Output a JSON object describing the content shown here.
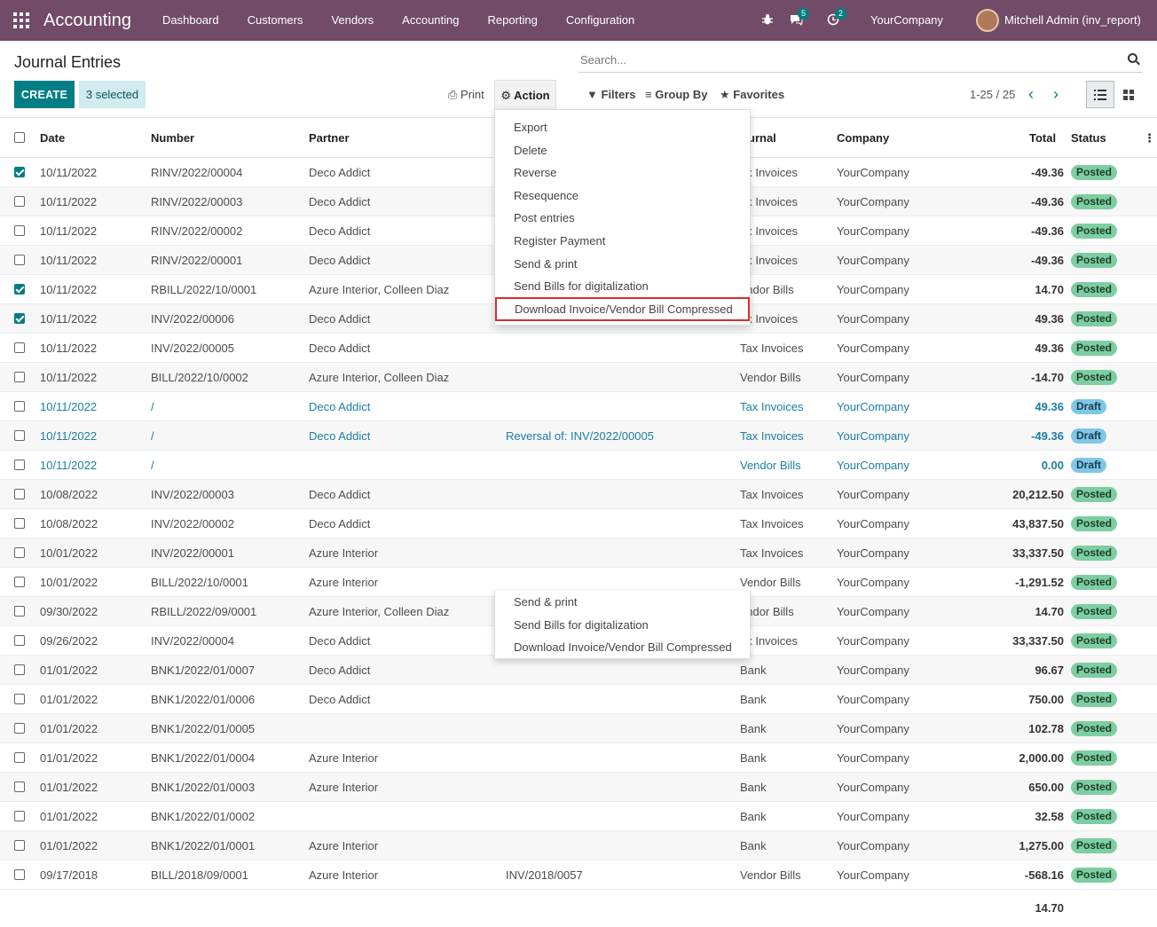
{
  "navbar": {
    "brand": "Accounting",
    "menu": [
      "Dashboard",
      "Customers",
      "Vendors",
      "Accounting",
      "Reporting",
      "Configuration"
    ],
    "chat_count": "5",
    "activity_count": "2",
    "company": "YourCompany",
    "user": "Mitchell Admin (inv_report)"
  },
  "control": {
    "title": "Journal Entries",
    "search_placeholder": "Search...",
    "create_label": "CREATE",
    "selected_label": "3 selected",
    "print_label": "Print",
    "action_label": "Action",
    "filters_label": "Filters",
    "groupby_label": "Group By",
    "favorites_label": "Favorites",
    "pager": "1-25 / 25"
  },
  "action_menu": {
    "items": [
      "Export",
      "Delete",
      "Reverse",
      "Resequence",
      "Post entries",
      "Register Payment",
      "Send & print",
      "Send Bills for digitalization",
      "Download Invoice/Vendor Bill Compressed"
    ],
    "ghost_items": [
      "Send & print",
      "Send Bills for digitalization",
      "Download Invoice/Vendor Bill Compressed"
    ]
  },
  "table": {
    "headers": {
      "date": "Date",
      "number": "Number",
      "partner": "Partner",
      "journal": "urnal",
      "company": "Company",
      "total": "Total",
      "status": "Status"
    },
    "rows": [
      {
        "checked": true,
        "date": "10/11/2022",
        "number": "RINV/2022/00004",
        "partner": "Deco Addict",
        "ref": "",
        "journal": "ax Invoices",
        "company": "YourCompany",
        "total": "-49.36",
        "status": "Posted"
      },
      {
        "checked": false,
        "date": "10/11/2022",
        "number": "RINV/2022/00003",
        "partner": "Deco Addict",
        "ref": "",
        "journal": "ax Invoices",
        "company": "YourCompany",
        "total": "-49.36",
        "status": "Posted"
      },
      {
        "checked": false,
        "date": "10/11/2022",
        "number": "RINV/2022/00002",
        "partner": "Deco Addict",
        "ref": "",
        "journal": "ax Invoices",
        "company": "YourCompany",
        "total": "-49.36",
        "status": "Posted"
      },
      {
        "checked": false,
        "date": "10/11/2022",
        "number": "RINV/2022/00001",
        "partner": "Deco Addict",
        "ref": "",
        "journal": "ax Invoices",
        "company": "YourCompany",
        "total": "-49.36",
        "status": "Posted"
      },
      {
        "checked": true,
        "date": "10/11/2022",
        "number": "RBILL/2022/10/0001",
        "partner": "Azure Interior, Colleen Diaz",
        "ref": "",
        "journal": "endor Bills",
        "company": "YourCompany",
        "total": "14.70",
        "status": "Posted"
      },
      {
        "checked": true,
        "date": "10/11/2022",
        "number": "INV/2022/00006",
        "partner": "Deco Addict",
        "ref": "",
        "journal": "ax Invoices",
        "company": "YourCompany",
        "total": "49.36",
        "status": "Posted"
      },
      {
        "checked": false,
        "date": "10/11/2022",
        "number": "INV/2022/00005",
        "partner": "Deco Addict",
        "ref": "",
        "journal": "Tax Invoices",
        "company": "YourCompany",
        "total": "49.36",
        "status": "Posted"
      },
      {
        "checked": false,
        "date": "10/11/2022",
        "number": "BILL/2022/10/0002",
        "partner": "Azure Interior, Colleen Diaz",
        "ref": "",
        "journal": "Vendor Bills",
        "company": "YourCompany",
        "total": "-14.70",
        "status": "Posted"
      },
      {
        "checked": false,
        "date": "10/11/2022",
        "number": "/",
        "partner": "Deco Addict",
        "ref": "",
        "journal": "Tax Invoices",
        "company": "YourCompany",
        "total": "49.36",
        "status": "Draft"
      },
      {
        "checked": false,
        "date": "10/11/2022",
        "number": "/",
        "partner": "Deco Addict",
        "ref": "Reversal of: INV/2022/00005",
        "journal": "Tax Invoices",
        "company": "YourCompany",
        "total": "-49.36",
        "status": "Draft"
      },
      {
        "checked": false,
        "date": "10/11/2022",
        "number": "/",
        "partner": "",
        "ref": "",
        "journal": "Vendor Bills",
        "company": "YourCompany",
        "total": "0.00",
        "status": "Draft"
      },
      {
        "checked": false,
        "date": "10/08/2022",
        "number": "INV/2022/00003",
        "partner": "Deco Addict",
        "ref": "",
        "journal": "Tax Invoices",
        "company": "YourCompany",
        "total": "20,212.50",
        "status": "Posted"
      },
      {
        "checked": false,
        "date": "10/08/2022",
        "number": "INV/2022/00002",
        "partner": "Deco Addict",
        "ref": "",
        "journal": "Tax Invoices",
        "company": "YourCompany",
        "total": "43,837.50",
        "status": "Posted"
      },
      {
        "checked": false,
        "date": "10/01/2022",
        "number": "INV/2022/00001",
        "partner": "Azure Interior",
        "ref": "",
        "journal": "Tax Invoices",
        "company": "YourCompany",
        "total": "33,337.50",
        "status": "Posted"
      },
      {
        "checked": false,
        "date": "10/01/2022",
        "number": "BILL/2022/10/0001",
        "partner": "Azure Interior",
        "ref": "",
        "journal": "Vendor Bills",
        "company": "YourCompany",
        "total": "-1,291.52",
        "status": "Posted"
      },
      {
        "checked": false,
        "date": "09/30/2022",
        "number": "RBILL/2022/09/0001",
        "partner": "Azure Interior, Colleen Diaz",
        "ref": "",
        "journal": "endor Bills",
        "company": "YourCompany",
        "total": "14.70",
        "status": "Posted"
      },
      {
        "checked": false,
        "date": "09/26/2022",
        "number": "INV/2022/00004",
        "partner": "Deco Addict",
        "ref": "",
        "journal": "ax Invoices",
        "company": "YourCompany",
        "total": "33,337.50",
        "status": "Posted"
      },
      {
        "checked": false,
        "date": "01/01/2022",
        "number": "BNK1/2022/01/0007",
        "partner": "Deco Addict",
        "ref": "",
        "journal": "Bank",
        "company": "YourCompany",
        "total": "96.67",
        "status": "Posted"
      },
      {
        "checked": false,
        "date": "01/01/2022",
        "number": "BNK1/2022/01/0006",
        "partner": "Deco Addict",
        "ref": "",
        "journal": "Bank",
        "company": "YourCompany",
        "total": "750.00",
        "status": "Posted"
      },
      {
        "checked": false,
        "date": "01/01/2022",
        "number": "BNK1/2022/01/0005",
        "partner": "",
        "ref": "",
        "journal": "Bank",
        "company": "YourCompany",
        "total": "102.78",
        "status": "Posted"
      },
      {
        "checked": false,
        "date": "01/01/2022",
        "number": "BNK1/2022/01/0004",
        "partner": "Azure Interior",
        "ref": "",
        "journal": "Bank",
        "company": "YourCompany",
        "total": "2,000.00",
        "status": "Posted"
      },
      {
        "checked": false,
        "date": "01/01/2022",
        "number": "BNK1/2022/01/0003",
        "partner": "Azure Interior",
        "ref": "",
        "journal": "Bank",
        "company": "YourCompany",
        "total": "650.00",
        "status": "Posted"
      },
      {
        "checked": false,
        "date": "01/01/2022",
        "number": "BNK1/2022/01/0002",
        "partner": "",
        "ref": "",
        "journal": "Bank",
        "company": "YourCompany",
        "total": "32.58",
        "status": "Posted"
      },
      {
        "checked": false,
        "date": "01/01/2022",
        "number": "BNK1/2022/01/0001",
        "partner": "Azure Interior",
        "ref": "",
        "journal": "Bank",
        "company": "YourCompany",
        "total": "1,275.00",
        "status": "Posted"
      },
      {
        "checked": false,
        "date": "09/17/2018",
        "number": "BILL/2018/09/0001",
        "partner": "Azure Interior",
        "ref": "INV/2018/0057",
        "journal": "Vendor Bills",
        "company": "YourCompany",
        "total": "-568.16",
        "status": "Posted"
      }
    ],
    "footer_total": "14.70"
  }
}
